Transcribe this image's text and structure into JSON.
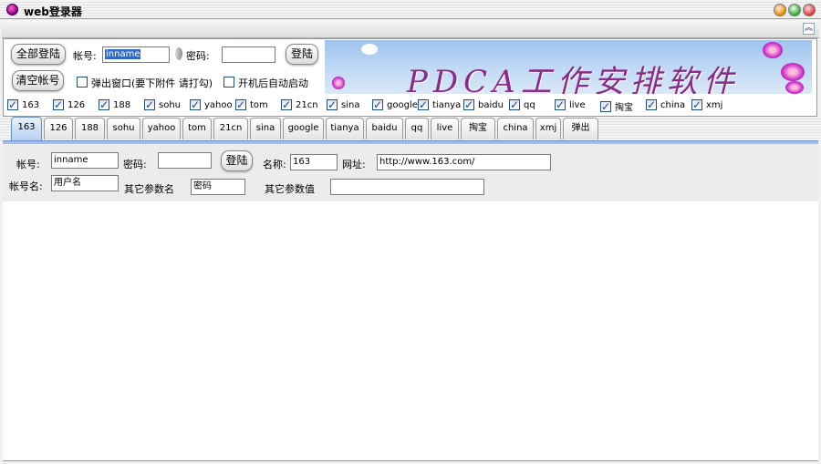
{
  "window": {
    "title": "web登录器"
  },
  "top": {
    "login_all": "全部登陆",
    "clear_accounts": "清空帐号",
    "account_label": "帐号:",
    "account_value": "inname",
    "password_label": "密码:",
    "password_value": "",
    "login": "登陆",
    "popup_checkbox": "弹出窗口(要下附件 请打勾)",
    "autostart_checkbox": "开机后自动启动",
    "banner_text": "PDCA工作安排软件"
  },
  "sites": [
    "163",
    "126",
    "188",
    "sohu",
    "yahoo",
    "tom",
    "21cn",
    "sina",
    "google",
    "tianya",
    "baidu",
    "qq",
    "live",
    "掏宝",
    "china",
    "xmj"
  ],
  "tabs": [
    "163",
    "126",
    "188",
    "sohu",
    "yahoo",
    "tom",
    "21cn",
    "sina",
    "google",
    "tianya",
    "baidu",
    "qq",
    "live",
    "掏宝",
    "china",
    "xmj",
    "弹出"
  ],
  "active_tab": "163",
  "form": {
    "account_label": "帐号:",
    "account_value": "inname",
    "password_label": "密码:",
    "password_value": "",
    "login": "登陆",
    "name_label": "名称:",
    "name_value": "163",
    "url_label": "网址:",
    "url_value": "http://www.163.com/",
    "account_name_label": "帐号名:",
    "account_name_value": "用户名",
    "other_param_name_label": "其它参数名",
    "other_param_name_value": "密码",
    "other_param_value_label": "其它参数值",
    "other_param_value_value": ""
  }
}
